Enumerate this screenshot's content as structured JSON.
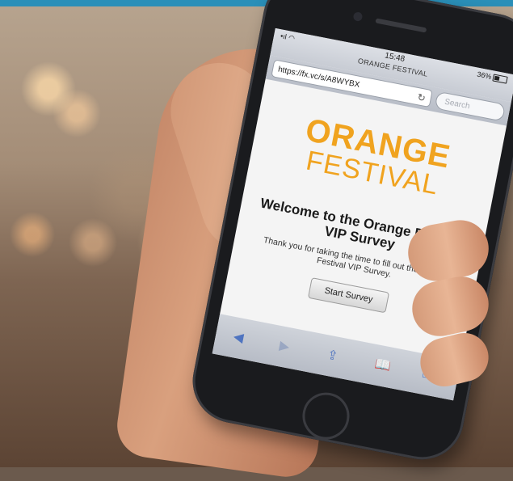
{
  "browser": {
    "status_time": "15:48",
    "battery": "36%",
    "page_title": "ORANGE FESTIVAL",
    "url": "https://fx.vc/s/A8WYBX",
    "search_placeholder": "Search"
  },
  "page": {
    "logo_line1": "ORANGE",
    "logo_line2": "FESTIVAL",
    "welcome_heading": "Welcome to the Orange Festival VIP Survey",
    "thanks_text": "Thank you for taking the time to fill out the Orange Festival VIP Survey.",
    "start_button": "Start Survey"
  },
  "icons": {
    "signal": "signal-wifi-icon",
    "refresh": "refresh-icon",
    "back": "back-icon",
    "forward": "forward-icon",
    "share": "share-icon",
    "bookmarks": "bookmarks-icon",
    "tabs": "tabs-icon"
  },
  "colors": {
    "brand_orange": "#f0a31f",
    "top_strip": "#2a8fb8"
  }
}
